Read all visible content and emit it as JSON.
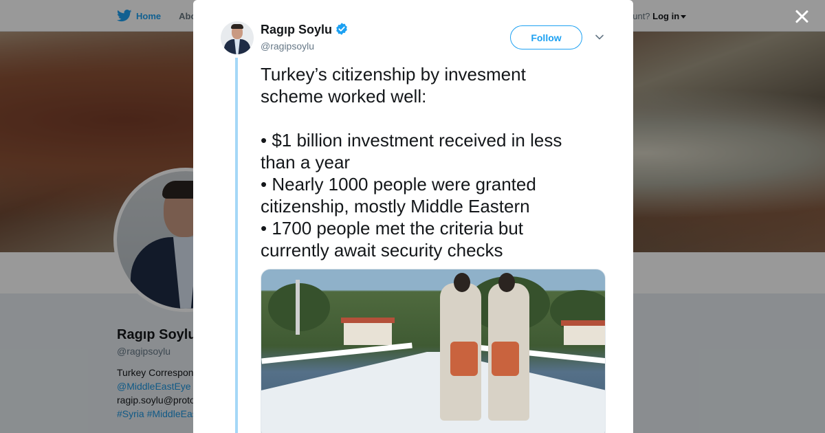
{
  "colors": {
    "accent": "#1da1f2",
    "link": "#1b95e0",
    "verified": "#1da1f2",
    "thread": "#a5d8f7"
  },
  "background_page": {
    "nav": {
      "home_label": "Home",
      "about_label": "Abo"
    },
    "login": {
      "prompt": "ccount?",
      "login_label": "Log in"
    },
    "profile": {
      "name": "Ragıp Soylu",
      "handle": "@ragipsoylu",
      "bio_line1": "Turkey Correspon",
      "bio_link": "@MiddleEastEye",
      "bio_line3": "ragip.soylu@proto",
      "bio_tags": "#Syria #MiddleEas"
    }
  },
  "tweet": {
    "author_name": "Ragıp Soylu",
    "author_handle": "@ragipsoylu",
    "follow_label": "Follow",
    "text_lines": [
      "Turkey’s citizenship by invesment",
      "scheme worked well:",
      "",
      "• $1 billion investment received in less",
      "than a year",
      "• Nearly 1000 people were granted",
      "citizenship, mostly Middle Eastern",
      "• 1700 people met the criteria but",
      "currently await security checks"
    ]
  },
  "icons": {
    "bird": "twitter-bird-icon",
    "verified": "verified-badge-icon",
    "chevron": "chevron-down-icon",
    "close": "close-icon"
  }
}
